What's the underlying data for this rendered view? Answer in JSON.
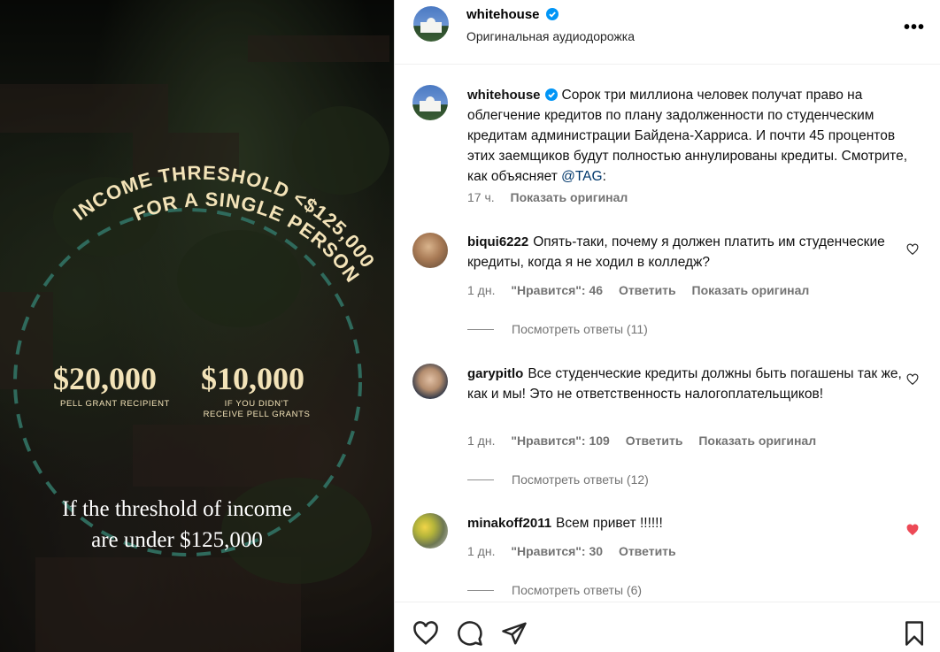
{
  "media": {
    "arc_top_text": "INCOME THRESHOLD <$125,000",
    "arc_sub_text": "FOR A SINGLE PERSON",
    "amount1": "$20,000",
    "amount1_label": "PELL GRANT RECIPIENT",
    "amount2": "$10,000",
    "amount2_label_line1": "IF YOU DIDN'T",
    "amount2_label_line2": "RECEIVE PELL GRANTS",
    "headline_line1": "If the threshold of income",
    "headline_line2": "are under $125,000"
  },
  "header": {
    "username": "whitehouse",
    "subtitle": "Оригинальная аудиодорожка",
    "more_label": "•••"
  },
  "caption": {
    "username": "whitehouse",
    "text": "Сорок три миллиона человек получат право на облегчение кредитов по плану задолженности по студенческим кредитам администрации Байдена-Харриса. И почти 45 процентов этих заемщиков будут полностью аннулированы кредиты. Смотрите, как объясняет ",
    "tag": "@TAG",
    "text_end": ":",
    "time": "17 ч.",
    "show_original": "Показать оригинал"
  },
  "comments": [
    {
      "username": "biqui6222",
      "text": "Опять-таки, почему я должен платить им студенческие кредиты, когда я не ходил в колледж?",
      "time": "1 дн.",
      "likes": "\"Нравится\": 46",
      "reply": "Ответить",
      "show_original": "Показать оригинал",
      "view_replies": "Посмотреть ответы (11)",
      "liked": false
    },
    {
      "username": "garypitlo",
      "text": "Все студенческие кредиты должны быть погашены так же, как и мы! Это не ответственность налогоплательщиков!",
      "time": "1 дн.",
      "likes": "\"Нравится\": 109",
      "reply": "Ответить",
      "show_original": "Показать оригинал",
      "view_replies": "Посмотреть ответы (12)",
      "liked": false
    },
    {
      "username": "minakoff2011",
      "text": "Всем привет !!!!!!",
      "time": "1 дн.",
      "likes": "\"Нравится\": 30",
      "reply": "Ответить",
      "view_replies": "Посмотреть ответы (6)",
      "liked": true
    }
  ],
  "colors": {
    "accent_text": "#f3e3b8",
    "ring": "#2f6a5c",
    "verified": "#0095f6",
    "liked_heart": "#ed4956"
  },
  "icons": [
    "like-icon",
    "comment-icon",
    "share-icon",
    "save-icon",
    "verified-icon",
    "heart-icon",
    "more-icon"
  ]
}
